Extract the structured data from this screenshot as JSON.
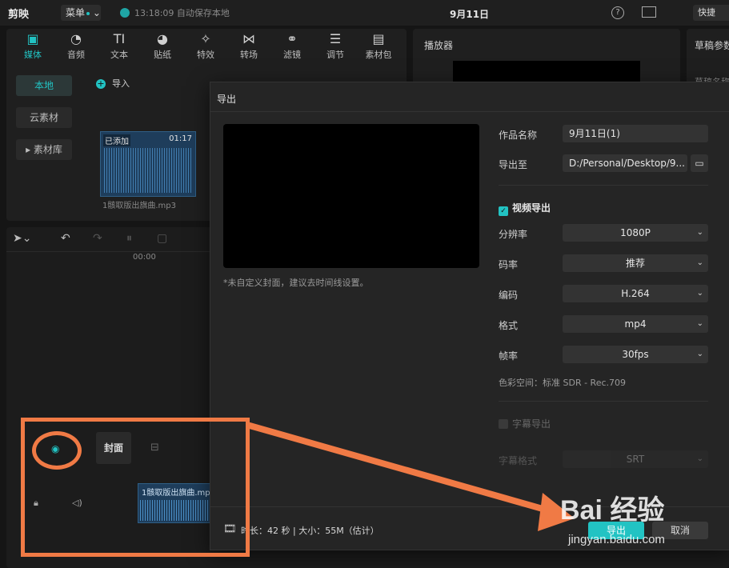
{
  "topbar": {
    "logo": "剪映",
    "menu": "菜单",
    "save_status": "13:18:09 自动保存本地",
    "project_title": "9月11日",
    "help": "?",
    "shortcut": "快捷"
  },
  "media_panel": {
    "tabs": [
      {
        "label": "媒体",
        "icon": "media-icon"
      },
      {
        "label": "音频",
        "icon": "audio-icon"
      },
      {
        "label": "文本",
        "icon": "text-icon"
      },
      {
        "label": "贴纸",
        "icon": "sticker-icon"
      },
      {
        "label": "特效",
        "icon": "effects-icon"
      },
      {
        "label": "转场",
        "icon": "transition-icon"
      },
      {
        "label": "滤镜",
        "icon": "filter-icon"
      },
      {
        "label": "调节",
        "icon": "adjust-icon"
      },
      {
        "label": "素材包",
        "icon": "package-icon"
      }
    ],
    "side_nav": [
      "本地",
      "云素材",
      "▸ 素材库"
    ],
    "import": "导入",
    "clip": {
      "added": "已添加",
      "duration": "01:17",
      "name": "1骸取版出旗曲.mp3"
    }
  },
  "player": {
    "title": "播放器"
  },
  "draft": {
    "title": "草稿参数",
    "name_label": "草稿名称"
  },
  "timeline": {
    "time": "00:00",
    "cover": "封面",
    "audio_clip": "1骸取版出旗曲.mp"
  },
  "dialog": {
    "title": "导出",
    "cover_hint": "*未自定义封面，建议去时间线设置。",
    "fields": {
      "name_label": "作品名称",
      "name_value": "9月11日(1)",
      "path_label": "导出至",
      "path_value": "D:/Personal/Desktop/9...",
      "video_export": "视频导出",
      "resolution_label": "分辨率",
      "resolution_value": "1080P",
      "bitrate_label": "码率",
      "bitrate_value": "推荐",
      "codec_label": "编码",
      "codec_value": "H.264",
      "format_label": "格式",
      "format_value": "mp4",
      "fps_label": "帧率",
      "fps_value": "30fps",
      "color_space": "色彩空间：标准 SDR - Rec.709",
      "subtitle_export": "字幕导出",
      "subtitle_format_label": "字幕格式",
      "subtitle_format_value": "SRT"
    },
    "footer": {
      "info": "时长：42 秒 | 大小：55M（估计）",
      "export": "导出",
      "cancel": "取消"
    }
  },
  "watermark": {
    "main": "Bai 经验",
    "sub": "jingyan.baidu.com"
  },
  "colors": {
    "accent": "#22c3c3",
    "annotation": "#f07a45",
    "dialog_bg": "#252525"
  }
}
